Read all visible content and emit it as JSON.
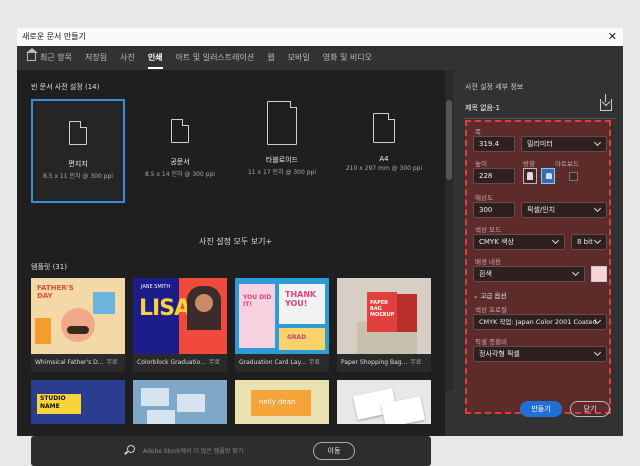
{
  "window": {
    "title": "새로운 문서 만들기",
    "close_glyph": "✕"
  },
  "tabs": [
    {
      "label": "최근 항목",
      "active": false,
      "icon": "home-icon"
    },
    {
      "label": "저장됨",
      "active": false
    },
    {
      "label": "사진",
      "active": false
    },
    {
      "label": "인쇄",
      "active": true
    },
    {
      "label": "아트 및 일러스트레이션",
      "active": false
    },
    {
      "label": "웹",
      "active": false
    },
    {
      "label": "모바일",
      "active": false
    },
    {
      "label": "영화 및 비디오",
      "active": false
    }
  ],
  "blank_presets": {
    "title": "빈 문서 사전 설정",
    "count": "(14)",
    "items": [
      {
        "name": "편지지",
        "dims": "8.5 x 11 인치 @ 300 ppi",
        "selected": true
      },
      {
        "name": "공문서",
        "dims": "8.5 x 14 인치 @ 300 ppi",
        "selected": false
      },
      {
        "name": "타블로이드",
        "dims": "11 x 17 인치 @ 300 ppi",
        "selected": false
      },
      {
        "name": "A4",
        "dims": "210 x 297 mm @ 300 ppi",
        "selected": false
      }
    ],
    "view_all": "사진 설정 모두 보기+"
  },
  "templates": {
    "title": "템플릿",
    "count": "(31)",
    "free_label": "무료",
    "items": [
      {
        "name": "Whimsical Father's D...",
        "art_text": "FATHER'S DAY"
      },
      {
        "name": "Colorblock Graduatio...",
        "art_text": "LISA"
      },
      {
        "name": "Graduation Card Lay...",
        "art_text": "YOU DID IT!"
      },
      {
        "name": "Paper Shopping Bag...",
        "art_text": "PAPER BAG MOCKUP"
      },
      {
        "name": "",
        "art_text": "STUDIO NAME"
      },
      {
        "name": "",
        "art_text": ""
      },
      {
        "name": "",
        "art_text": "nelly dean"
      },
      {
        "name": "",
        "art_text": ""
      }
    ],
    "thank_you": "THANK YOU!",
    "grad_text": "GRAD",
    "jane": "JANE SMITH"
  },
  "search": {
    "placeholder": "Adobe Stock에서 더 많은 템플릿 찾기",
    "go_label": "이동"
  },
  "details": {
    "title": "사전 설정 세부 정보",
    "doc_name": "제목 없음-1",
    "width_label": "폭",
    "width_value": "319.4",
    "width_unit": "밀리미터",
    "height_label": "높이",
    "height_value": "228",
    "orientation_label": "방향",
    "artboard_label": "아트보드",
    "resolution_label": "해상도",
    "resolution_value": "300",
    "resolution_unit": "픽셀/인치",
    "color_mode_label": "색상 모드",
    "color_mode_value": "CMYK 색상",
    "bit_depth": "8 bit",
    "bg_label": "배경 내용",
    "bg_value": "흰색",
    "bg_color": "#f5d5d5",
    "advanced_label": "고급 옵션",
    "color_profile_label": "색상 프로필",
    "color_profile_value": "CMYK 작업: Japan Color 2001 Coated",
    "pixel_aspect_label": "픽셀 종횡비",
    "pixel_aspect_value": "정사각형 픽셀",
    "create_button": "만들기",
    "close_button": "닫기"
  },
  "colors": {
    "accent": "#1f6fd6",
    "highlight_border": "#e23c3c",
    "highlight_fill": "#5e2b2b"
  }
}
